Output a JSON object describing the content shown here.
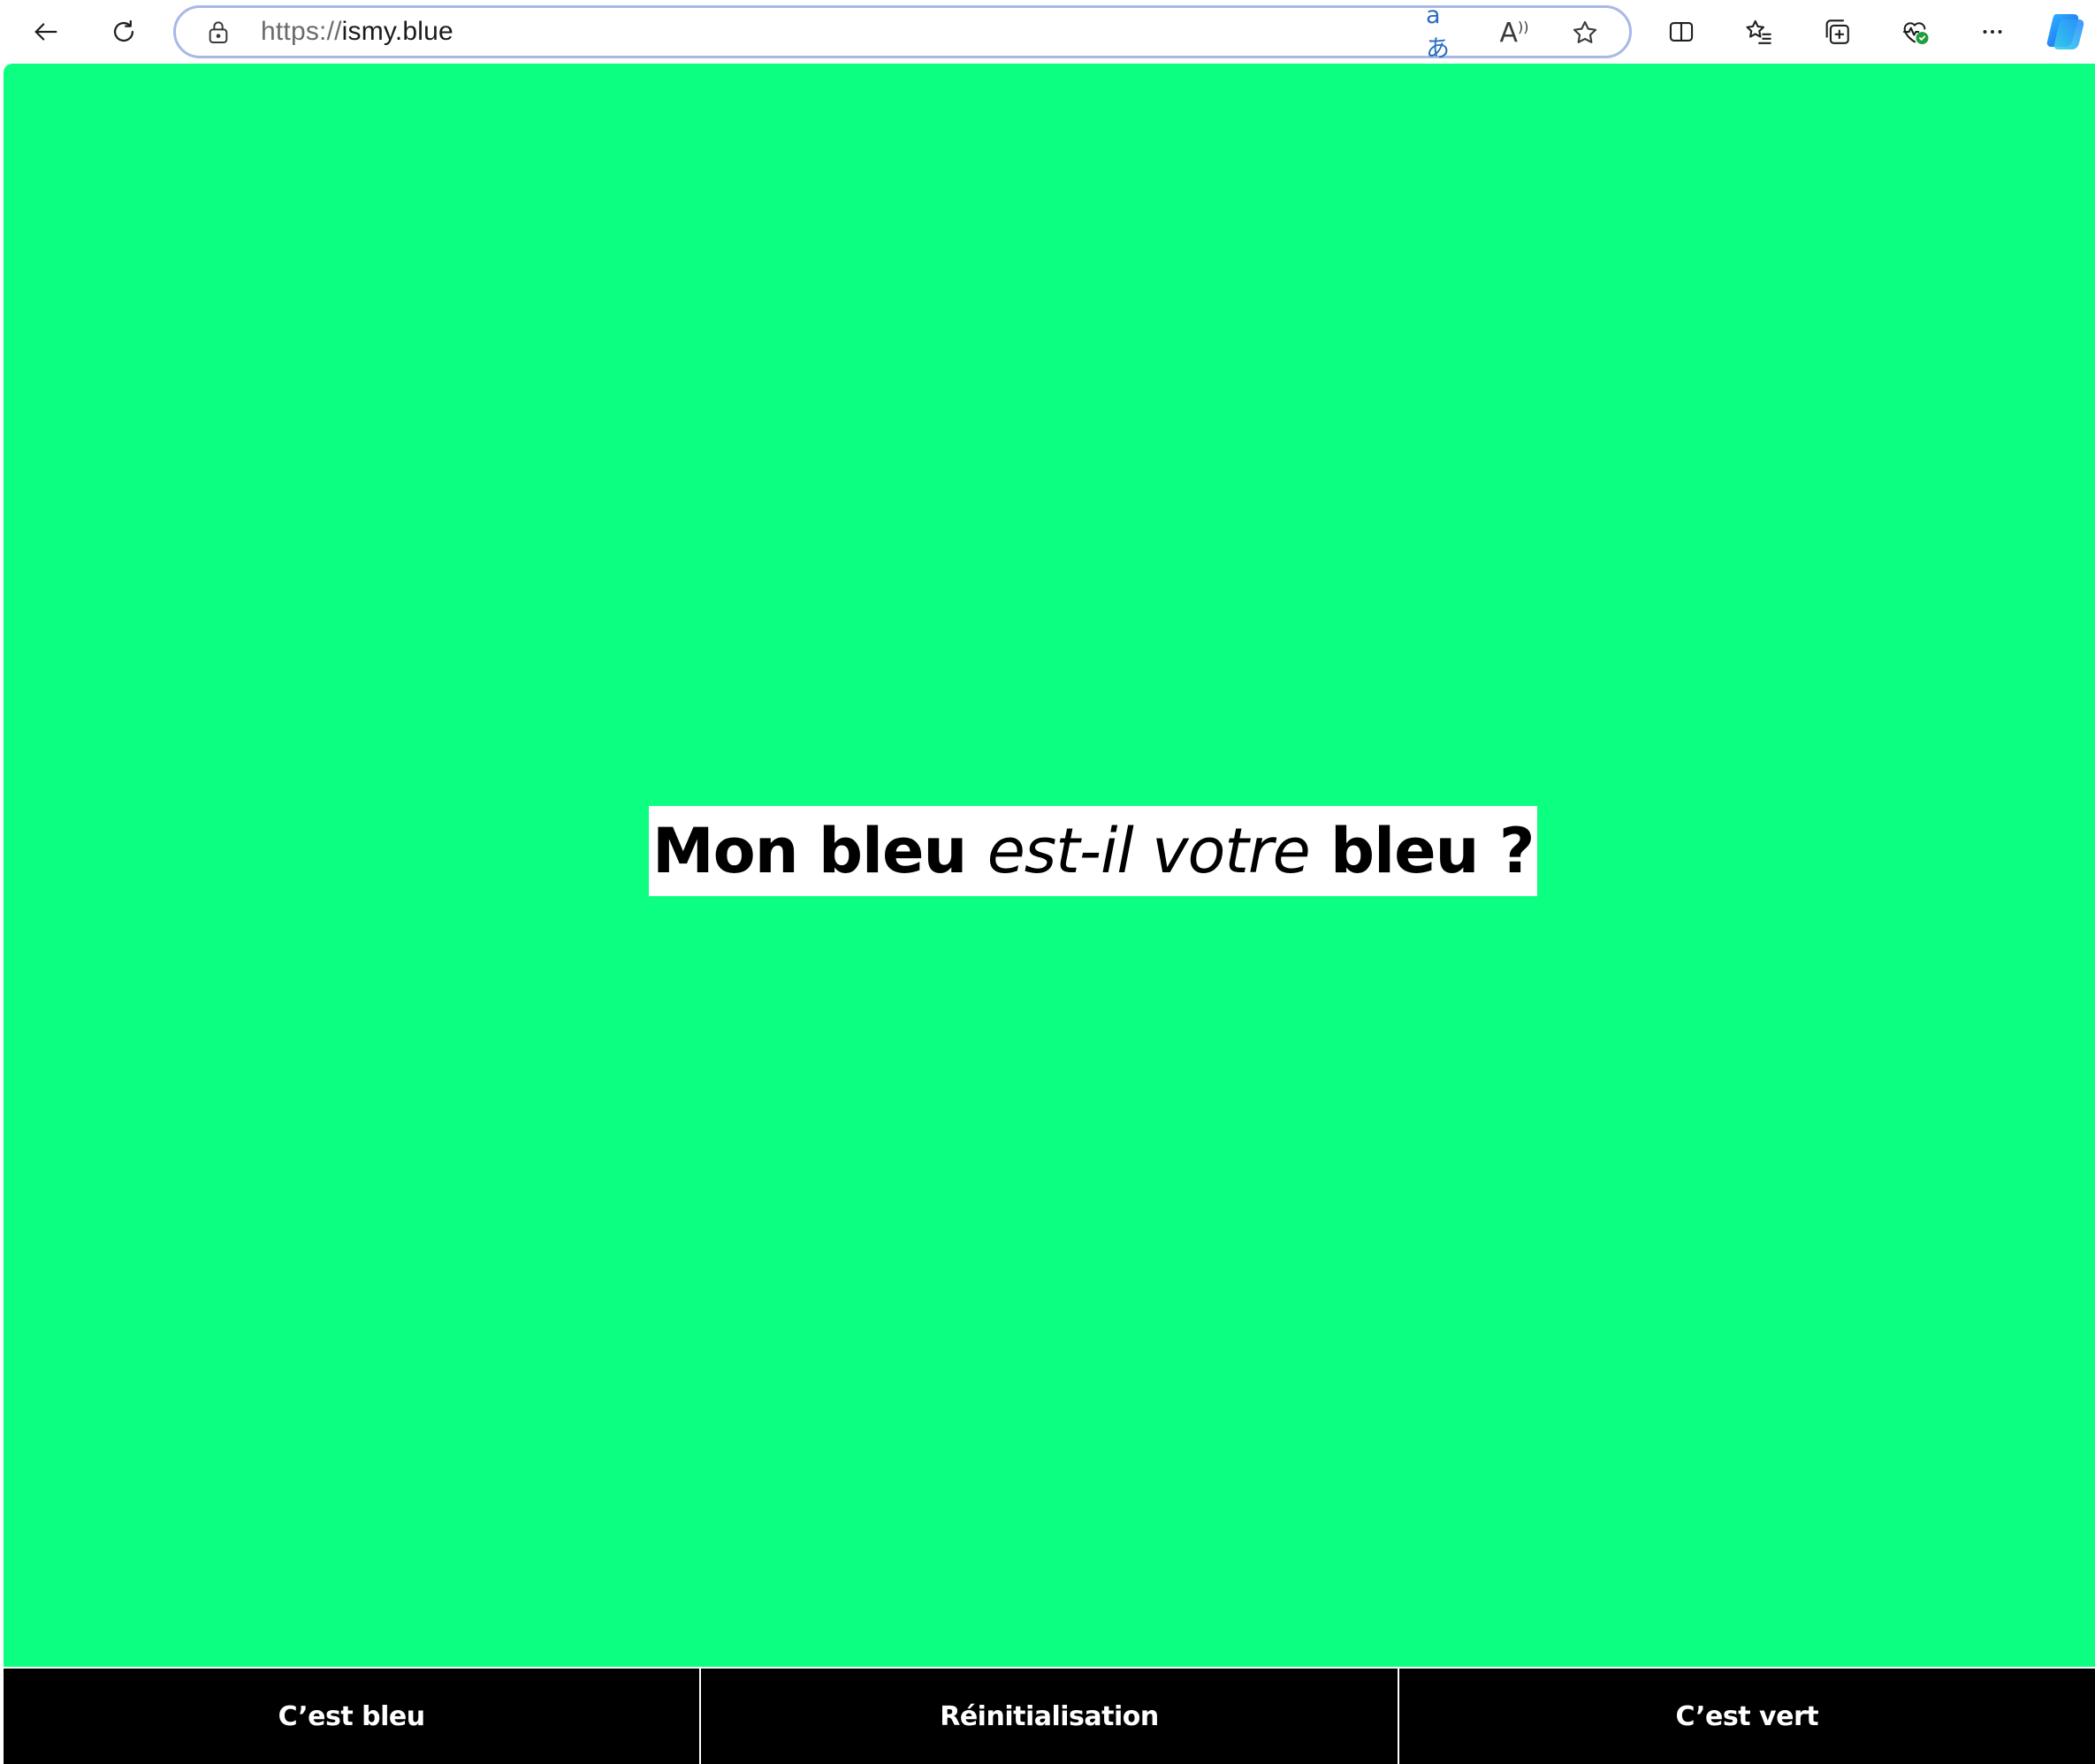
{
  "browser": {
    "url_protocol": "https://",
    "url_host": "ismy.blue",
    "translate_glyph": "aあ",
    "read_aloud_glyph": "A",
    "icons": {
      "back": "back-arrow-icon",
      "refresh": "refresh-icon",
      "lock": "lock-icon",
      "translate": "translate-icon",
      "read_aloud": "read-aloud-icon",
      "favorite": "star-icon",
      "split_screen": "split-screen-icon",
      "favorites": "favorites-list-icon",
      "collections": "collections-icon",
      "browser_essentials": "heart-pulse-icon",
      "more": "more-icon",
      "copilot": "copilot-icon"
    }
  },
  "page": {
    "background_color": "#0cff80",
    "question": {
      "part1": "Mon bleu ",
      "part2_italic": "est-il votre",
      "part3": " bleu ?"
    },
    "buttons": {
      "blue": "C’est bleu",
      "reset": "Réinitialisation",
      "green": "C’est vert"
    }
  }
}
